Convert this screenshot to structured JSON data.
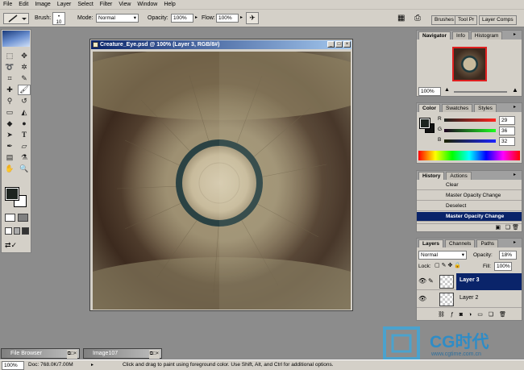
{
  "menu": [
    "File",
    "Edit",
    "Image",
    "Layer",
    "Select",
    "Filter",
    "View",
    "Window",
    "Help"
  ],
  "options": {
    "brush_label": "Brush:",
    "brush_size": "10",
    "mode_label": "Mode:",
    "mode_value": "Normal",
    "opacity_label": "Opacity:",
    "opacity_value": "100%",
    "flow_label": "Flow:",
    "flow_value": "100%"
  },
  "palette_well": [
    "Brushes",
    "Tool Pr",
    "Layer Comps"
  ],
  "document": {
    "title": "Creature_Eye.psd @ 100% (Layer 3, RGB/8#)"
  },
  "navigator": {
    "tabs": [
      "Navigator",
      "Info",
      "Histogram"
    ],
    "zoom": "100%"
  },
  "color": {
    "tabs": [
      "Color",
      "Swatches",
      "Styles"
    ],
    "r_label": "R",
    "r_value": "29",
    "g_label": "G",
    "g_value": "36",
    "b_label": "B",
    "b_value": "32"
  },
  "history": {
    "tabs": [
      "History",
      "Actions"
    ],
    "items": [
      "Clear",
      "Master Opacity Change",
      "Deselect",
      "Master Opacity Change"
    ]
  },
  "layers": {
    "tabs": [
      "Layers",
      "Channels",
      "Paths"
    ],
    "blend_mode": "Normal",
    "opacity_label": "Opacity:",
    "opacity_value": "18%",
    "lock_label": "Lock:",
    "fill_label": "Fill:",
    "fill_value": "100%",
    "items": [
      "Layer 3",
      "Layer 2"
    ]
  },
  "minimized": [
    "File Browser",
    "Image107"
  ],
  "status": {
    "zoom": "100%",
    "doc": "Doc: 768.0K/7.00M",
    "hint": "Click and drag to paint using foreground color.  Use Shift, Alt, and Ctrl for additional options."
  },
  "watermark": {
    "brand": "CG时代",
    "url": "www.cgtime.com.cn"
  },
  "colors": {
    "accent": "#0a246a",
    "selected_layer": "#0a246a",
    "foreground": "#1d2420",
    "iris": "#d2c7ac"
  },
  "icons": [
    "brush-icon",
    "move-icon",
    "marquee-icon",
    "lasso-icon",
    "wand-icon",
    "crop-icon",
    "slice-icon",
    "heal-icon",
    "stamp-icon",
    "history-brush-icon",
    "eraser-icon",
    "bucket-icon",
    "blur-icon",
    "dodge-icon",
    "path-select-icon",
    "type-icon",
    "pen-icon",
    "shape-icon",
    "notes-icon",
    "eyedropper-icon",
    "hand-icon",
    "zoom-icon",
    "eye-icon",
    "trash-icon"
  ]
}
